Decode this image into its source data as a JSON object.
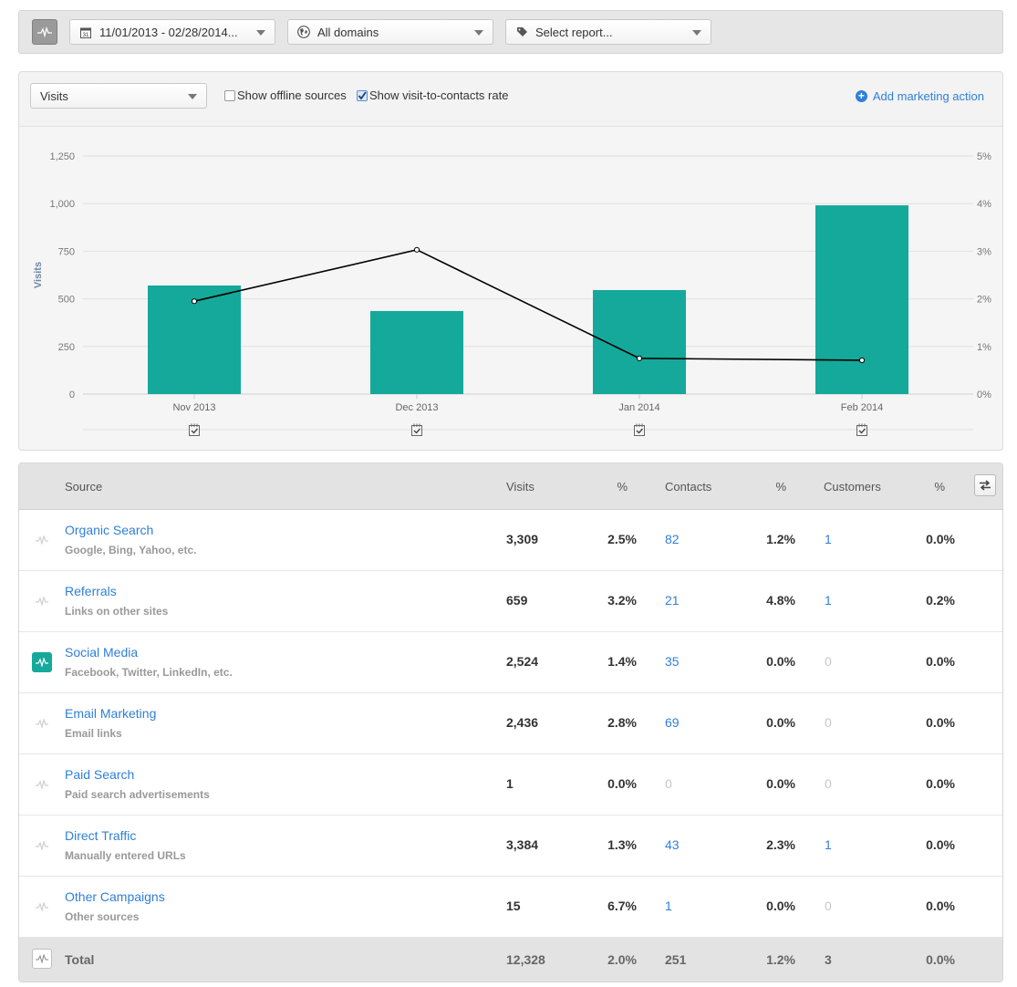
{
  "filters": {
    "date_range": "11/01/2013 - 02/28/2014...",
    "domains": "All domains",
    "report": "Select report..."
  },
  "chart_toolbar": {
    "metric": "Visits",
    "show_offline_label": "Show offline sources",
    "show_offline_checked": false,
    "show_rate_label": "Show visit-to-contacts rate",
    "show_rate_checked": true,
    "add_action_label": "Add marketing action"
  },
  "colors": {
    "bar": "#14a99a",
    "line": "#000000",
    "link": "#2f7fd8"
  },
  "chart_data": {
    "type": "bar",
    "title": "",
    "xlabel": "",
    "ylabel": "Visits",
    "categories": [
      "Nov 2013",
      "Dec 2013",
      "Jan 2014",
      "Feb 2014"
    ],
    "series": [
      {
        "name": "Visits",
        "type": "bar",
        "axis": "left",
        "values": [
          570,
          436,
          546,
          991
        ]
      },
      {
        "name": "Visit-to-contacts rate",
        "type": "line",
        "axis": "right",
        "unit": "%",
        "values": [
          1.95,
          3.03,
          0.75,
          0.71
        ]
      }
    ],
    "ylim": [
      0,
      1250
    ],
    "y_ticks": [
      "0",
      "250",
      "500",
      "750",
      "1,000",
      "1,250"
    ],
    "y2lim": [
      0,
      5
    ],
    "y2_ticks": [
      "0%",
      "1%",
      "2%",
      "3%",
      "4%",
      "5%"
    ],
    "grid": true,
    "legend": "none",
    "annotations": [
      "marketing-action-marker",
      "marketing-action-marker",
      "marketing-action-marker",
      "marketing-action-marker"
    ]
  },
  "table": {
    "headers": {
      "source": "Source",
      "visits": "Visits",
      "visits_pct": "%",
      "contacts": "Contacts",
      "contacts_pct": "%",
      "customers": "Customers",
      "customers_pct": "%"
    },
    "rows": [
      {
        "name": "Organic Search",
        "sub": "Google, Bing, Yahoo, etc.",
        "visits": "3,309",
        "visits_pct": "2.5%",
        "contacts": "82",
        "contacts_pct": "1.2%",
        "customers": "1",
        "customers_pct": "0.0%",
        "active": false
      },
      {
        "name": "Referrals",
        "sub": "Links on other sites",
        "visits": "659",
        "visits_pct": "3.2%",
        "contacts": "21",
        "contacts_pct": "4.8%",
        "customers": "1",
        "customers_pct": "0.2%",
        "active": false
      },
      {
        "name": "Social Media",
        "sub": "Facebook, Twitter, LinkedIn, etc.",
        "visits": "2,524",
        "visits_pct": "1.4%",
        "contacts": "35",
        "contacts_pct": "0.0%",
        "customers": "0",
        "customers_pct": "0.0%",
        "active": true
      },
      {
        "name": "Email Marketing",
        "sub": "Email links",
        "visits": "2,436",
        "visits_pct": "2.8%",
        "contacts": "69",
        "contacts_pct": "0.0%",
        "customers": "0",
        "customers_pct": "0.0%",
        "active": false
      },
      {
        "name": "Paid Search",
        "sub": "Paid search advertisements",
        "visits": "1",
        "visits_pct": "0.0%",
        "contacts": "0",
        "contacts_pct": "0.0%",
        "customers": "0",
        "customers_pct": "0.0%",
        "active": false
      },
      {
        "name": "Direct Traffic",
        "sub": "Manually entered URLs",
        "visits": "3,384",
        "visits_pct": "1.3%",
        "contacts": "43",
        "contacts_pct": "2.3%",
        "customers": "1",
        "customers_pct": "0.0%",
        "active": false
      },
      {
        "name": "Other Campaigns",
        "sub": "Other sources",
        "visits": "15",
        "visits_pct": "6.7%",
        "contacts": "1",
        "contacts_pct": "0.0%",
        "customers": "0",
        "customers_pct": "0.0%",
        "active": false
      }
    ],
    "total": {
      "name": "Total",
      "visits": "12,328",
      "visits_pct": "2.0%",
      "contacts": "251",
      "contacts_pct": "1.2%",
      "customers": "3",
      "customers_pct": "0.0%"
    }
  }
}
